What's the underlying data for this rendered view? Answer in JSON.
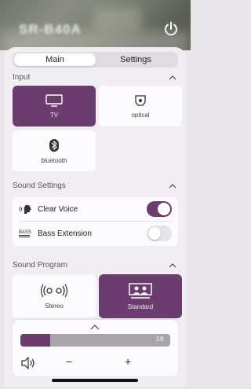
{
  "header": {
    "device_name": "SR-B40A"
  },
  "tabs": [
    {
      "label": "Main"
    },
    {
      "label": "Settings"
    }
  ],
  "input": {
    "title": "Input",
    "sources": [
      {
        "label": "TV",
        "icon": "tv-icon",
        "selected": true
      },
      {
        "label": "optical",
        "icon": "optical-icon",
        "selected": false
      },
      {
        "label": "bluetooth",
        "icon": "bluetooth-icon",
        "selected": false
      }
    ]
  },
  "sound_settings": {
    "title": "Sound Settings",
    "clear_voice": {
      "label": "Clear Voice",
      "on": true
    },
    "bass_extension": {
      "label": "Bass Extension",
      "icon_text": "BASS",
      "on": false
    }
  },
  "sound_program": {
    "title": "Sound Program",
    "programs": [
      {
        "label": "Stereo",
        "icon": "stereo-speakers-icon",
        "selected": false
      },
      {
        "label": "Standard",
        "icon": "standard-program-icon",
        "selected": true
      }
    ]
  },
  "volume": {
    "value": "10",
    "fraction": 0.2,
    "minus": "−",
    "plus": "+"
  },
  "colors": {
    "accent": "#6b3d6f",
    "panel": "#f0eef2",
    "tile": "#fbfafc"
  }
}
